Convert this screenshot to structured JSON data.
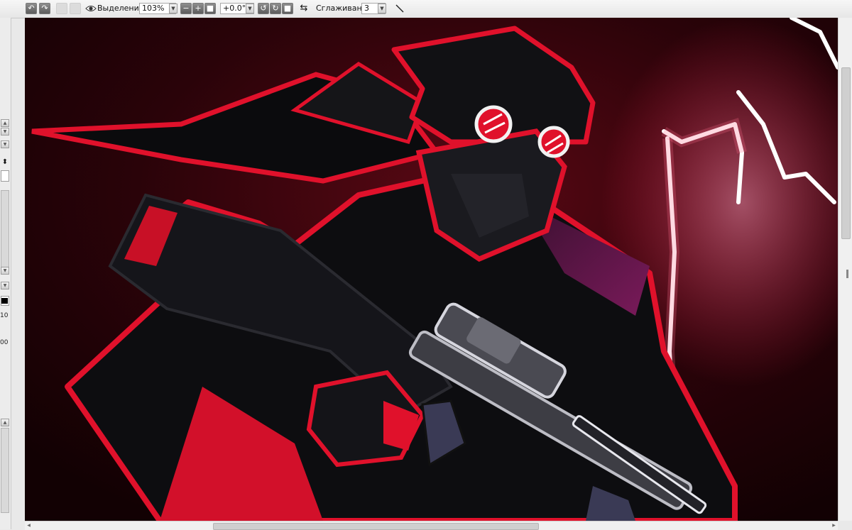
{
  "toolbar": {
    "selection_label": "Выделение",
    "zoom_value": "103%",
    "rotation_value": "+0.0°",
    "smoothing_label": "Сглаживание",
    "smoothing_value": "3"
  },
  "left_panel": {
    "value_a": "10",
    "value_b": "00"
  },
  "canvas": {
    "accent_color": "#e0112b",
    "background_color": "#1a0205"
  }
}
